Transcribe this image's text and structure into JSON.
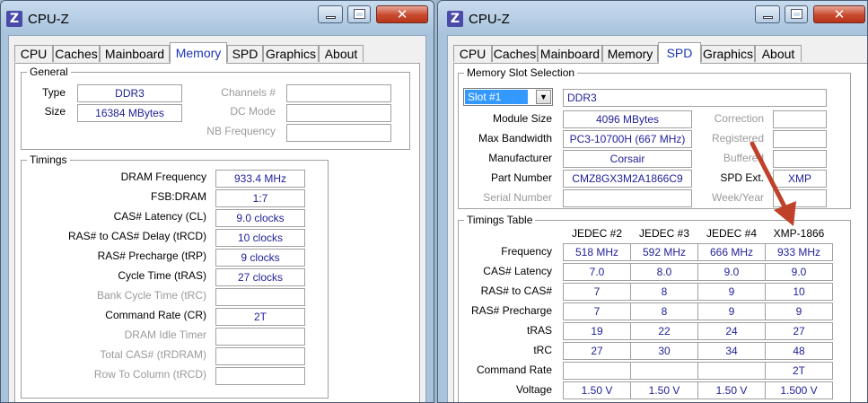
{
  "colors": {
    "value_text": "#1f1f98",
    "active_tab": "#1b33b8",
    "arrow": "#c0412a",
    "close_button": "#c84a2e"
  },
  "left": {
    "app_icon": "Z",
    "title": "CPU-Z",
    "tabs": [
      "CPU",
      "Caches",
      "Mainboard",
      "Memory",
      "SPD",
      "Graphics",
      "About"
    ],
    "active_tab": "Memory",
    "general": {
      "legend": "General",
      "type_label": "Type",
      "type_value": "DDR3",
      "size_label": "Size",
      "size_value": "16384 MBytes",
      "channels_label": "Channels #",
      "channels_value": "",
      "dcmode_label": "DC Mode",
      "dcmode_value": "",
      "nbfreq_label": "NB Frequency",
      "nbfreq_value": ""
    },
    "timings": {
      "legend": "Timings",
      "rows": [
        {
          "label": "DRAM Frequency",
          "value": "933.4 MHz"
        },
        {
          "label": "FSB:DRAM",
          "value": "1:7"
        },
        {
          "label": "CAS# Latency (CL)",
          "value": "9.0 clocks"
        },
        {
          "label": "RAS# to CAS# Delay (tRCD)",
          "value": "10 clocks"
        },
        {
          "label": "RAS# Precharge (tRP)",
          "value": "9 clocks"
        },
        {
          "label": "Cycle Time (tRAS)",
          "value": "27 clocks"
        },
        {
          "label": "Bank Cycle Time (tRC)",
          "value": ""
        },
        {
          "label": "Command Rate (CR)",
          "value": "2T"
        },
        {
          "label": "DRAM Idle Timer",
          "value": ""
        },
        {
          "label": "Total CAS# (tRDRAM)",
          "value": ""
        },
        {
          "label": "Row To Column (tRCD)",
          "value": ""
        }
      ]
    }
  },
  "right": {
    "app_icon": "Z",
    "title": "CPU-Z",
    "tabs": [
      "CPU",
      "Caches",
      "Mainboard",
      "Memory",
      "SPD",
      "Graphics",
      "About"
    ],
    "active_tab": "SPD",
    "slot": {
      "legend": "Memory Slot Selection",
      "selected": "Slot #1",
      "type_value": "DDR3",
      "module_size_label": "Module Size",
      "module_size_value": "4096 MBytes",
      "max_bw_label": "Max Bandwidth",
      "max_bw_value": "PC3-10700H (667 MHz)",
      "manufacturer_label": "Manufacturer",
      "manufacturer_value": "Corsair",
      "part_label": "Part Number",
      "part_value": "CMZ8GX3M2A1866C9",
      "serial_label": "Serial Number",
      "serial_value": "",
      "correction_label": "Correction",
      "correction_value": "",
      "registered_label": "Registered",
      "registered_value": "",
      "buffered_label": "Buffered",
      "buffered_value": "",
      "spdext_label": "SPD Ext.",
      "spdext_value": "XMP",
      "weekyear_label": "Week/Year",
      "weekyear_value": ""
    },
    "timings_table": {
      "legend": "Timings Table",
      "columns": [
        "JEDEC #2",
        "JEDEC #3",
        "JEDEC #4",
        "XMP-1866"
      ],
      "rows": [
        {
          "label": "Frequency",
          "values": [
            "518 MHz",
            "592 MHz",
            "666 MHz",
            "933 MHz"
          ]
        },
        {
          "label": "CAS# Latency",
          "values": [
            "7.0",
            "8.0",
            "9.0",
            "9.0"
          ]
        },
        {
          "label": "RAS# to CAS#",
          "values": [
            "7",
            "8",
            "9",
            "10"
          ]
        },
        {
          "label": "RAS# Precharge",
          "values": [
            "7",
            "8",
            "9",
            "9"
          ]
        },
        {
          "label": "tRAS",
          "values": [
            "19",
            "22",
            "24",
            "27"
          ]
        },
        {
          "label": "tRC",
          "values": [
            "27",
            "30",
            "34",
            "48"
          ]
        },
        {
          "label": "Command Rate",
          "values": [
            "",
            "",
            "",
            "2T"
          ]
        },
        {
          "label": "Voltage",
          "values": [
            "1.50 V",
            "1.50 V",
            "1.50 V",
            "1.500 V"
          ]
        }
      ]
    }
  }
}
